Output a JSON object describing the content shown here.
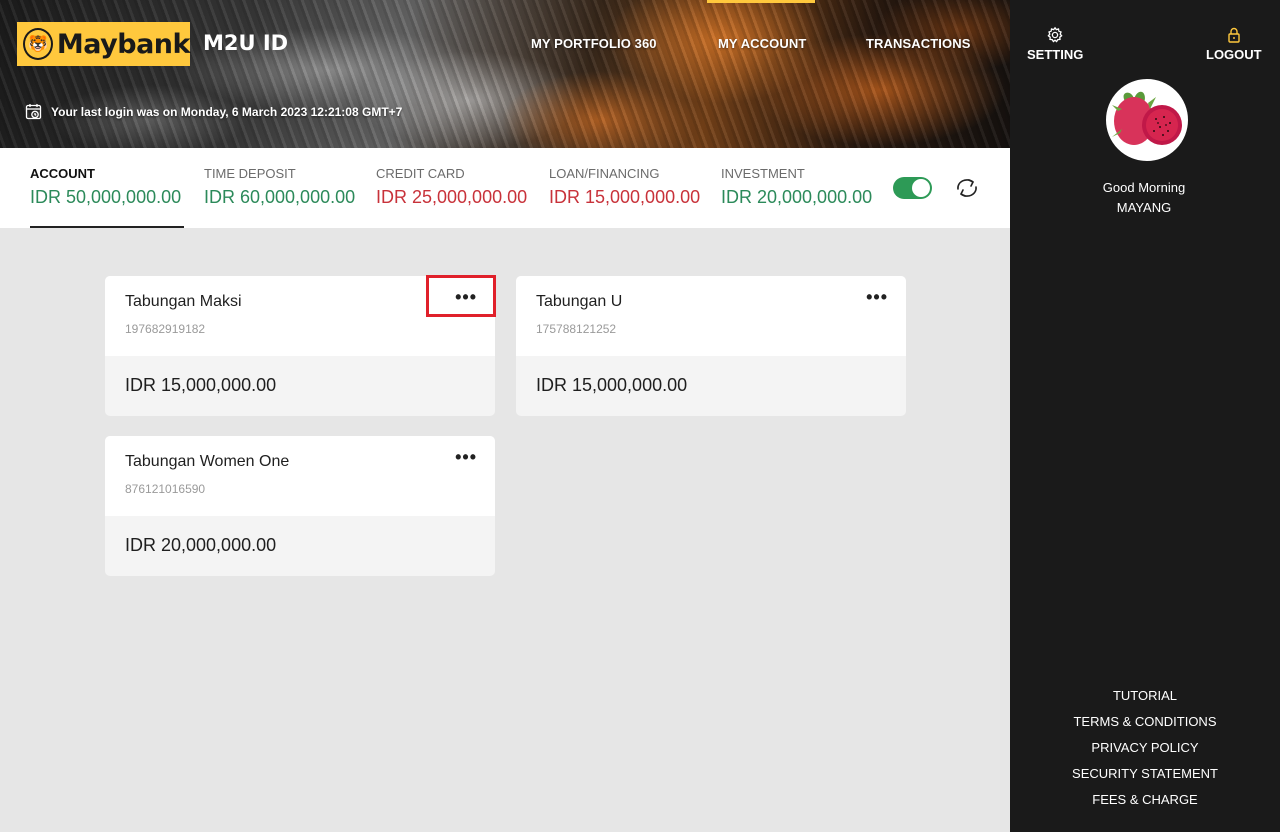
{
  "brand": {
    "logo_text": "Maybank",
    "app_title": "M2U ID",
    "accent": "#ffc83d"
  },
  "nav": {
    "items": [
      {
        "label": "MY PORTFOLIO 360"
      },
      {
        "label": "MY ACCOUNT",
        "active": true
      },
      {
        "label": "TRANSACTIONS"
      }
    ]
  },
  "last_login": "Your last login was on Monday, 6 March 2023 12:21:08 GMT+7",
  "summary": {
    "tabs": [
      {
        "label": "ACCOUNT",
        "value": "IDR 50,000,000.00",
        "color": "#2c8a5a",
        "active": true
      },
      {
        "label": "TIME DEPOSIT",
        "value": "IDR 60,000,000.00",
        "color": "#2c8a5a"
      },
      {
        "label": "CREDIT CARD",
        "value": "IDR 25,000,000.00",
        "color": "#c8323a"
      },
      {
        "label": "LOAN/FINANCING",
        "value": "IDR 15,000,000.00",
        "color": "#c8323a"
      },
      {
        "label": "INVESTMENT",
        "value": "IDR 20,000,000.00",
        "color": "#2c8a5a"
      }
    ],
    "toggle_on": true
  },
  "accounts": [
    {
      "name": "Tabungan Maksi",
      "number": "197682919182",
      "balance": "IDR 15,000,000.00",
      "menu": "•••"
    },
    {
      "name": "Tabungan U",
      "number": "175788121252",
      "balance": "IDR 15,000,000.00",
      "menu": "•••"
    },
    {
      "name": "Tabungan Women One",
      "number": "876121016590",
      "balance": "IDR 20,000,000.00",
      "menu": "•••"
    }
  ],
  "sidebar": {
    "setting_label": "SETTING",
    "logout_label": "LOGOUT",
    "greeting_line1": "Good Morning",
    "greeting_line2": "MAYANG",
    "footer_links": [
      "TUTORIAL",
      "TERMS & CONDITIONS",
      "PRIVACY POLICY",
      "SECURITY STATEMENT",
      "FEES & CHARGE"
    ]
  }
}
